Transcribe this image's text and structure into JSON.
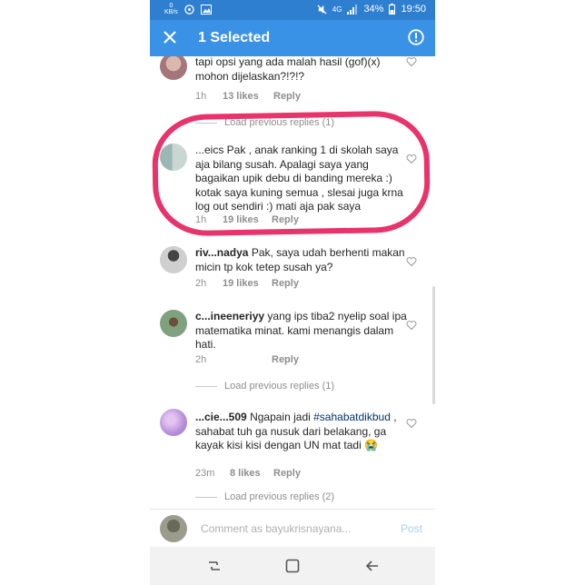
{
  "status_bar": {
    "kb_value": "0",
    "kb_unit": "KB/s",
    "network": "4G",
    "battery": "34%",
    "time": "19:50"
  },
  "app_bar": {
    "title": "1 Selected"
  },
  "comments": [
    {
      "username": "",
      "text": "tapi opsi yang ada malah hasil (gof)(x) mohon dijelaskan?!?!?",
      "time": "1h",
      "likes": "13 likes",
      "reply": "Reply"
    },
    {
      "username": "",
      "text": "...eics Pak , anak ranking 1 di skolah saya aja bilang susah. Apalagi saya yang bagaikan upik debu di banding mereka :) kotak saya kuning semua , slesai juga krna log out sendiri :) mati aja pak saya",
      "time": "1h",
      "likes": "19 likes",
      "reply": "Reply"
    },
    {
      "username": "riv...nadya",
      "text": "Pak, saya udah berhenti makan micin tp kok tetep susah ya?",
      "time": "2h",
      "likes": "19 likes",
      "reply": "Reply"
    },
    {
      "username": "c...ineeneriyy",
      "text": "yang ips tiba2 nyelip soal ipa matematika minat. kami menangis dalam hati.",
      "time": "2h",
      "likes": "",
      "reply": "Reply"
    },
    {
      "username": "...cie...509",
      "text": "Ngapain jadi #sahabatdikbud , sahabat tuh ga nusuk dari belakang, ga kayak kisi kisi dengan UN mat tadi 😭",
      "time": "23m",
      "likes": "8 likes",
      "reply": "Reply"
    }
  ],
  "load_previous": [
    "Load previous replies (1)",
    "Load previous replies (1)",
    "Load previous replies (2)"
  ],
  "comment_bar": {
    "placeholder": "Comment as bayukrisnayana...",
    "post_label": "Post"
  },
  "colors": {
    "status_bar": "#2f7fd1",
    "app_bar": "#3a92e6",
    "highlight": "#e8336b"
  },
  "icons": [
    "close-icon",
    "info-icon",
    "heart-icon",
    "recent-apps-icon",
    "home-icon",
    "back-icon"
  ]
}
